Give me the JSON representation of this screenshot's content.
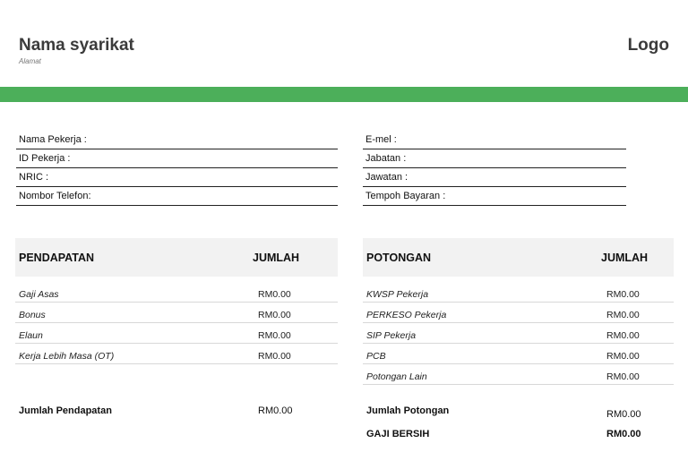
{
  "header": {
    "company_name": "Nama syarikat",
    "address": "Alamat",
    "logo": "Logo"
  },
  "colors": {
    "accent": "#4caf5a",
    "table_header_bg": "#f2f2f2"
  },
  "employee_info": {
    "left": [
      "Nama Pekerja :",
      "ID Pekerja :",
      "NRIC :",
      "Nombor Telefon:"
    ],
    "right": [
      "E-mel :",
      "Jabatan :",
      "Jawatan :",
      "Tempoh Bayaran :"
    ]
  },
  "earnings": {
    "header": "PENDAPATAN",
    "amount_header": "JUMLAH",
    "rows": [
      {
        "label": "Gaji Asas",
        "amount": "RM0.00"
      },
      {
        "label": "Bonus",
        "amount": "RM0.00"
      },
      {
        "label": "Elaun",
        "amount": "RM0.00"
      },
      {
        "label": "Kerja Lebih Masa (OT)",
        "amount": "RM0.00"
      }
    ],
    "total_label": "Jumlah Pendapatan",
    "total_amount": "RM0.00"
  },
  "deductions": {
    "header": "POTONGAN",
    "amount_header": "JUMLAH",
    "rows": [
      {
        "label": "KWSP Pekerja",
        "amount": "RM0.00"
      },
      {
        "label": "PERKESO Pekerja",
        "amount": "RM0.00"
      },
      {
        "label": "SIP Pekerja",
        "amount": "RM0.00"
      },
      {
        "label": "PCB",
        "amount": "RM0.00"
      },
      {
        "label": "Potongan Lain",
        "amount": "RM0.00"
      }
    ],
    "total_label": "Jumlah Potongan",
    "total_amount": "RM0.00",
    "net_label": "GAJI BERSIH",
    "net_amount": "RM0.00"
  }
}
